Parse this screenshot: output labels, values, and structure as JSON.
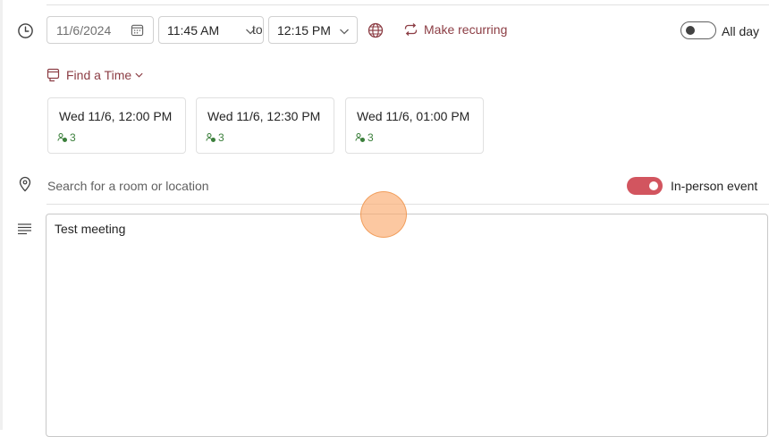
{
  "schedule": {
    "date_value": "11/6/2024",
    "start_time": "11:45 AM",
    "to_label": "to",
    "end_time": "12:15 PM",
    "make_recurring_label": "Make recurring",
    "all_day_label": "All day",
    "all_day_enabled": false
  },
  "find_time": {
    "label": "Find a Time",
    "suggestions": [
      {
        "time": "Wed 11/6, 12:00 PM",
        "attendees": "3"
      },
      {
        "time": "Wed 11/6, 12:30 PM",
        "attendees": "3"
      },
      {
        "time": "Wed 11/6, 01:00 PM",
        "attendees": "3"
      }
    ]
  },
  "location": {
    "placeholder": "Search for a room or location",
    "in_person_label": "In-person event",
    "in_person_enabled": true
  },
  "body": {
    "text": "Test meeting"
  },
  "colors": {
    "accent": "#8c3d44",
    "toggle_on": "#d2555f",
    "attendee_green": "#3b7f3b"
  }
}
